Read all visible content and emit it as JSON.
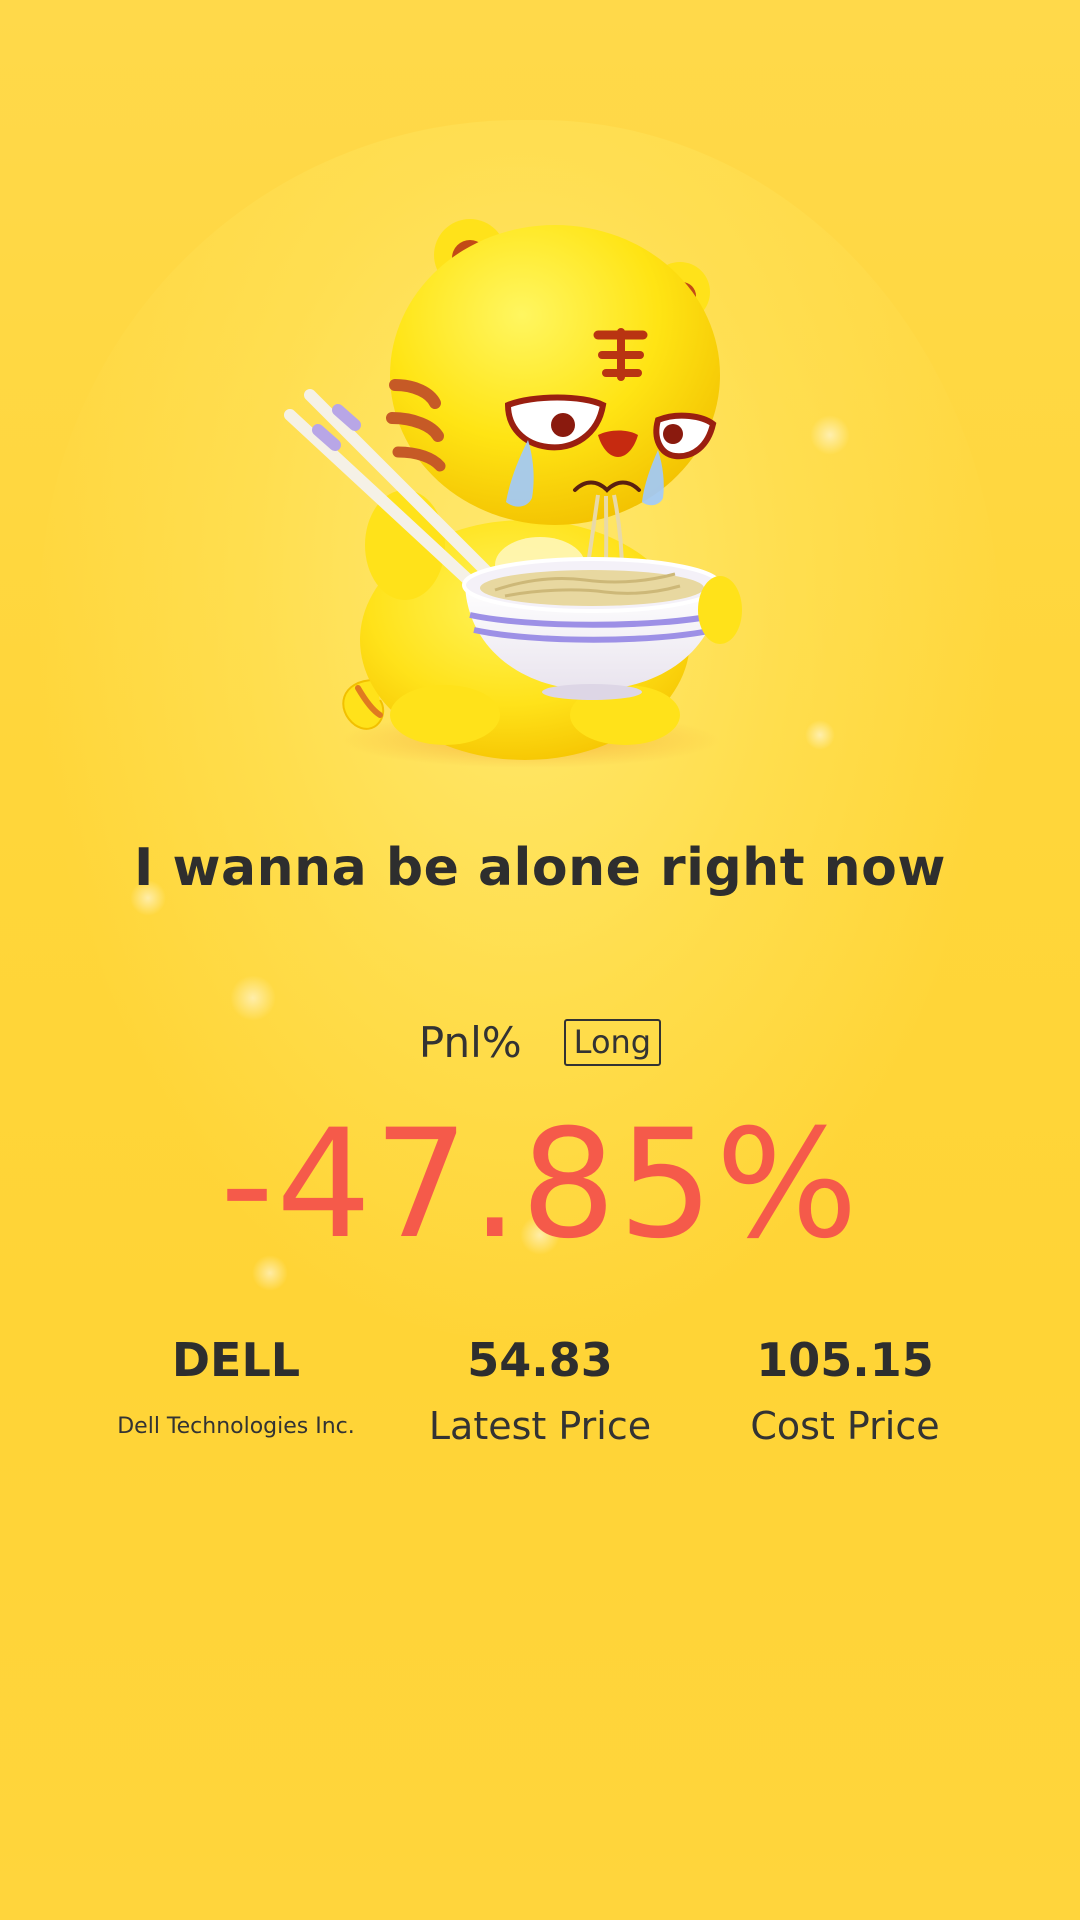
{
  "headline": "I wanna be alone right now",
  "pnl": {
    "label": "Pnl%",
    "direction": "Long",
    "value": "-47.85%"
  },
  "stock": {
    "ticker": "DELL",
    "company": "Dell Technologies Inc."
  },
  "latest": {
    "value": "54.83",
    "label": "Latest Price"
  },
  "cost": {
    "value": "105.15",
    "label": "Cost Price"
  },
  "colors": {
    "background": "#ffd63a",
    "loss": "#f55a4a",
    "text": "#2e2e2e"
  },
  "icons": {
    "mascot": "crying-tiger-eating-noodles-illustration"
  }
}
